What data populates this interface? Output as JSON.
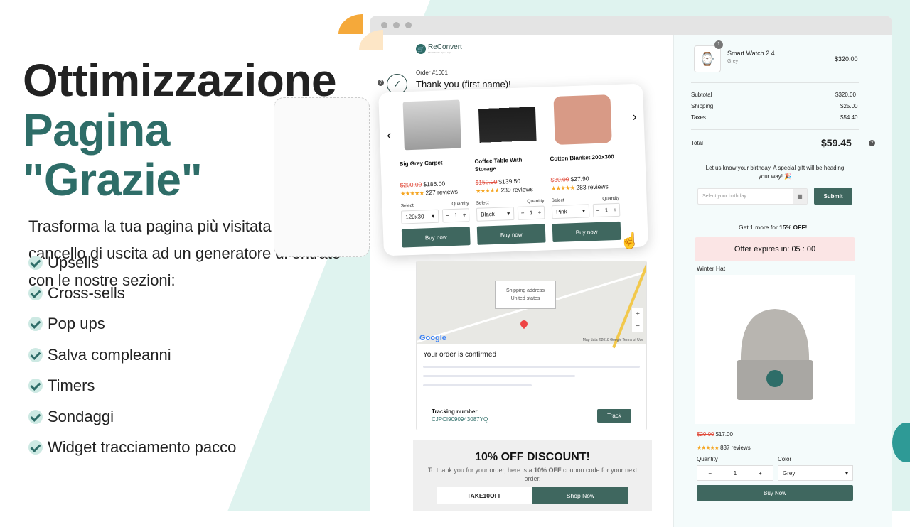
{
  "hero": {
    "title_line1": "Ottimizzazione",
    "title_line2": "Pagina \"Grazie\"",
    "subtitle": "Trasforma la tua pagina più visitata da un cancello di uscita ad un generatore di entrate con le nostre sezioni:",
    "features": [
      "Upsells",
      "Cross-sells",
      "Pop ups",
      "Salva compleanni",
      "Timers",
      "Sondaggi",
      "Widget tracciamento pacco"
    ]
  },
  "colors": {
    "accent": "#2e6d68",
    "button": "#3f675f",
    "sale_price": "#e04a3a",
    "star": "#f5a623",
    "timer_bg": "#fbe5e5"
  },
  "store": {
    "logo_name": "ReConvert",
    "logo_tagline": "The Ultimate Upsell App",
    "order_number": "Order #1001",
    "thanks": "Thank you (first name)!"
  },
  "carousel": {
    "prev_icon": "‹",
    "next_icon": "›",
    "products": [
      {
        "name": "Big Grey Carpet",
        "old_price": "$200.00",
        "price": "$186.00",
        "stars": "★★★★★",
        "reviews": "227 reviews",
        "select_label": "Select",
        "quantity_label": "Quantity",
        "option": "120x30",
        "qty": "1",
        "buy": "Buy now"
      },
      {
        "name": "Coffee Table With Storage",
        "old_price": "$150.00",
        "price": "$139.50",
        "stars": "★★★★★",
        "reviews": "239 reviews",
        "select_label": "Select",
        "quantity_label": "Quantity",
        "option": "Black",
        "qty": "1",
        "buy": "Buy now"
      },
      {
        "name": "Cotton Blanket 200x300",
        "old_price": "$30.00",
        "price": "$27.90",
        "stars": "★★★★★",
        "reviews": "283 reviews",
        "select_label": "Select",
        "quantity_label": "Quantity",
        "option": "Pink",
        "qty": "1",
        "buy": "Buy now"
      }
    ]
  },
  "map": {
    "bubble_line1": "Shipping address",
    "bubble_line2": "United states",
    "zoom_in": "+",
    "zoom_out": "−",
    "google": "Google",
    "attribution": "Map data ©2018 Google   Terms of Use"
  },
  "tracking": {
    "confirmed": "Your order is confirmed",
    "label": "Tracking number",
    "number": "CJPCI9090943087YQ",
    "button": "Track"
  },
  "discount": {
    "title": "10% OFF DISCOUNT!",
    "text_before": "To thank you for your order, here is a ",
    "text_bold": "10% OFF",
    "text_after": " coupon code for your next order.",
    "code": "TAKE10OFF",
    "button": "Shop Now"
  },
  "summary": {
    "item_name": "Smart Watch 2.4",
    "item_variant": "Grey",
    "item_qty_badge": "1",
    "item_price": "$320.00",
    "subtotal_label": "Subtotal",
    "subtotal": "$320.00",
    "shipping_label": "Shipping",
    "shipping": "$25.00",
    "taxes_label": "Taxes",
    "taxes": "$54.40",
    "total_label": "Total",
    "total": "$59.45"
  },
  "birthday": {
    "text": "Let us know your birthday. A special gift will be heading your way! 🎉",
    "placeholder": "Select your birthday",
    "button": "Submit"
  },
  "offer": {
    "headline_before": "Get 1 more for ",
    "headline_bold": "15% OFF!",
    "timer_label": "Offer expires in: ",
    "timer": "05 : 00",
    "product_name": "Winter Hat",
    "old_price": "$20.00",
    "price": "$17.00",
    "stars": "★★★★★",
    "reviews": "837 reviews",
    "quantity_label": "Quantity",
    "quantity": "1",
    "color_label": "Color",
    "color": "Grey",
    "buy": "Buy Now"
  }
}
